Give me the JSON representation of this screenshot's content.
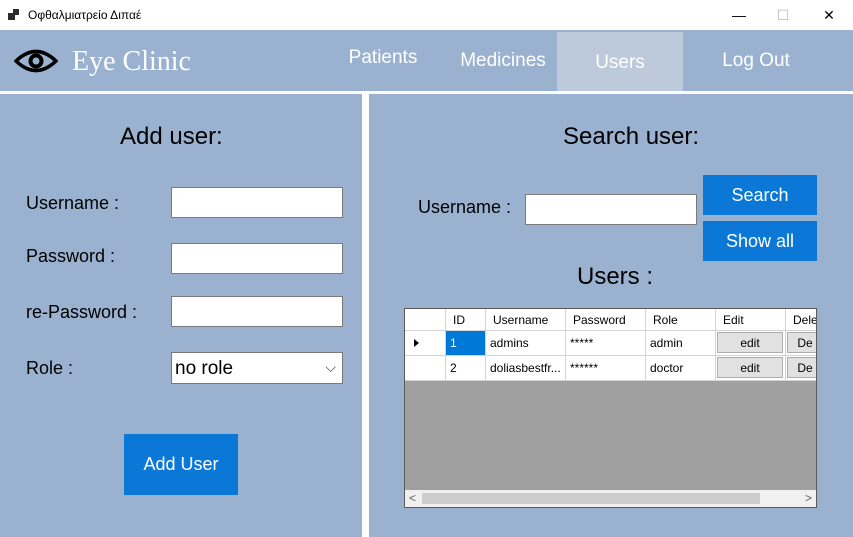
{
  "window": {
    "title": "Οφθαλμιατρείο Διπαέ",
    "minimize": "—",
    "maximize": "☐",
    "close": "✕"
  },
  "header": {
    "brand": "Eye Clinic",
    "nav": {
      "patients": "Patients",
      "medicines": "Medicines",
      "users": "Users",
      "logout": "Log Out"
    }
  },
  "add_user": {
    "title": "Add user:",
    "username_label": "Username :",
    "password_label": "Password :",
    "repassword_label": "re-Password :",
    "role_label": "Role :",
    "role_value": "no role",
    "button": "Add User"
  },
  "search_user": {
    "title": "Search user:",
    "username_label": "Username :",
    "search_button": "Search",
    "showall_button": "Show all",
    "users_title": "Users :"
  },
  "grid": {
    "columns": [
      "ID",
      "Username",
      "Password",
      "Role",
      "Edit",
      "Dele"
    ],
    "rows": [
      {
        "id": "1",
        "username": "admins",
        "password": "*****",
        "role": "admin",
        "edit": "edit",
        "delete": "De"
      },
      {
        "id": "2",
        "username": "doliasbestfr...",
        "password": "******",
        "role": "doctor",
        "edit": "edit",
        "delete": "De"
      }
    ]
  },
  "colors": {
    "panel": "#9ab2cf",
    "nav_active": "#bccadb",
    "button": "#0b78d7",
    "selection": "#0078d7"
  }
}
